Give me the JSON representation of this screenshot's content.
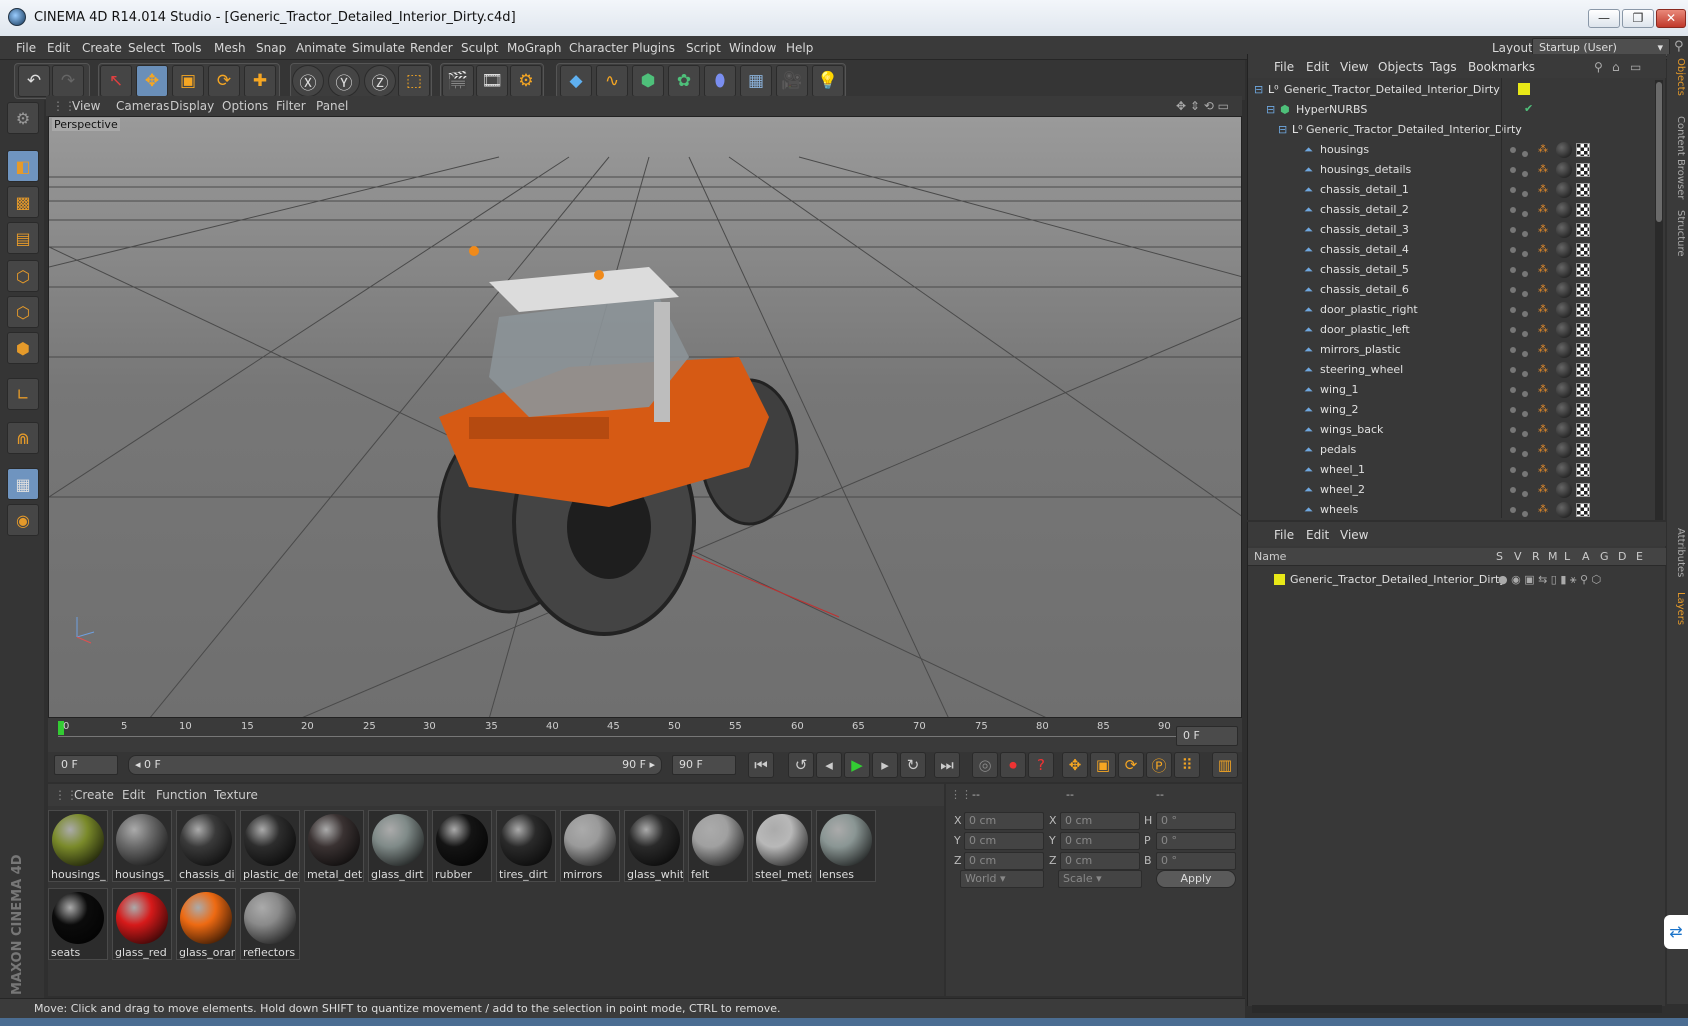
{
  "title_bar": {
    "title": "CINEMA 4D R14.014 Studio - [Generic_Tractor_Detailed_Interior_Dirty.c4d]",
    "min": "—",
    "max": "❐",
    "close": "✕"
  },
  "menu": [
    "File",
    "Edit",
    "Create",
    "Select",
    "Tools",
    "Mesh",
    "Snap",
    "Animate",
    "Simulate",
    "Render",
    "Sculpt",
    "MoGraph",
    "Character",
    "Plugins",
    "Script",
    "Window",
    "Help"
  ],
  "layout": {
    "label": "Layout:",
    "value": "Startup (User)"
  },
  "viewport": {
    "menu": [
      "View",
      "Cameras",
      "Display",
      "Options",
      "Filter",
      "Panel"
    ],
    "label": "Perspective"
  },
  "timeline": {
    "ticks": [
      "0",
      "5",
      "10",
      "15",
      "20",
      "25",
      "30",
      "35",
      "40",
      "45",
      "50",
      "55",
      "60",
      "65",
      "70",
      "75",
      "80",
      "85",
      "90"
    ],
    "end_field": "0 F",
    "start_field": "0 F",
    "range_left": "◂ 0 F",
    "range_right": "90 F ▸",
    "max_field": "90 F",
    "current_frame": 0
  },
  "materials": {
    "menu": [
      "Create",
      "Edit",
      "Function",
      "Texture"
    ],
    "items": [
      {
        "label": "housings_",
        "color": "#7a8a2a"
      },
      {
        "label": "housings_",
        "color": "#6a6a6a"
      },
      {
        "label": "chassis_dir",
        "color": "#3a3a3a"
      },
      {
        "label": "plastic_det",
        "color": "#2d2d2d"
      },
      {
        "label": "metal_deta",
        "color": "#3a3232"
      },
      {
        "label": "glass_dirt",
        "color": "#7f8a88"
      },
      {
        "label": "rubber",
        "color": "#141414"
      },
      {
        "label": "tires_dirt",
        "color": "#2a2a2a"
      },
      {
        "label": "mirrors",
        "color": "#9a9a9a"
      },
      {
        "label": "glass_whit",
        "color": "#2a2a2a"
      },
      {
        "label": "felt",
        "color": "#a0a0a0"
      },
      {
        "label": "steel_metal",
        "color": "#b8b8b8"
      },
      {
        "label": "lenses",
        "color": "#8a9694"
      },
      {
        "label": "seats",
        "color": "#0b0b0b"
      },
      {
        "label": "glass_red",
        "color": "#d61a1a"
      },
      {
        "label": "glass_oran",
        "color": "#ee6a12"
      },
      {
        "label": "reflectors",
        "color": "#8a8a8a"
      }
    ]
  },
  "coords": {
    "headers": [
      "--",
      "--",
      "--"
    ],
    "rows": [
      {
        "a": "X",
        "av": "0 cm",
        "b": "X",
        "bv": "0 cm",
        "c": "H",
        "cv": "0 °"
      },
      {
        "a": "Y",
        "av": "0 cm",
        "b": "Y",
        "bv": "0 cm",
        "c": "P",
        "cv": "0 °"
      },
      {
        "a": "Z",
        "av": "0 cm",
        "b": "Z",
        "bv": "0 cm",
        "c": "B",
        "cv": "0 °"
      }
    ],
    "world": "World",
    "scale": "Scale",
    "apply": "Apply"
  },
  "status": "Move: Click and drag to move elements. Hold down SHIFT to quantize movement / add to the selection in point mode, CTRL to remove.",
  "objects": {
    "menu": [
      "File",
      "Edit",
      "View",
      "Objects",
      "Tags",
      "Bookmarks"
    ],
    "root": "Generic_Tractor_Detailed_Interior_Dirty",
    "hypernurbs": "HyperNURBS",
    "group": "Generic_Tractor_Detailed_Interior_Dirty",
    "children": [
      "housings",
      "housings_details",
      "chassis_detail_1",
      "chassis_detail_2",
      "chassis_detail_3",
      "chassis_detail_4",
      "chassis_detail_5",
      "chassis_detail_6",
      "door_plastic_right",
      "door_plastic_left",
      "mirrors_plastic",
      "steering_wheel",
      "wing_1",
      "wing_2",
      "wings_back",
      "pedals",
      "wheel_1",
      "wheel_2",
      "wheels"
    ]
  },
  "layers": {
    "menu": [
      "File",
      "Edit",
      "View"
    ],
    "columns": [
      "Name",
      "S",
      "V",
      "R",
      "M",
      "L",
      "A",
      "G",
      "D",
      "E"
    ],
    "rows": [
      "Generic_Tractor_Detailed_Interior_Dirty"
    ]
  },
  "side_tabs": [
    "Objects",
    "Content Browser",
    "Structure",
    "Attributes",
    "Layers"
  ],
  "maxon_logo": "MAXON CINEMA 4D",
  "colors": {
    "accent": "#6a8fb9",
    "tractor": "#d65a14",
    "layer_color": "#e8e817"
  }
}
